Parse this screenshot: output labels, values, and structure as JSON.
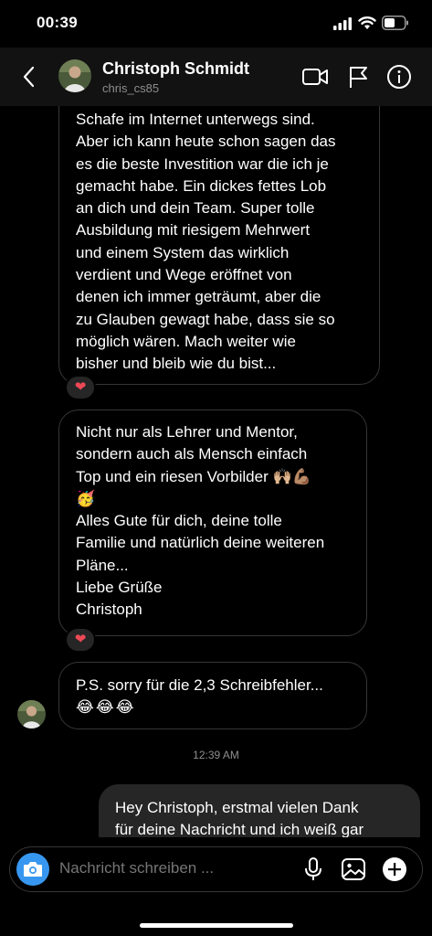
{
  "status_bar": {
    "time": "00:39"
  },
  "header": {
    "name": "Christoph Schmidt",
    "handle": "chris_cs85",
    "icons": [
      "back-arrow-icon",
      "video-call-icon",
      "flag-icon",
      "info-icon"
    ]
  },
  "messages": [
    {
      "lines": [
        "Schafe im Internet unterwegs sind.",
        "Aber ich kann heute schon sagen das",
        "es die beste Investition war die ich je",
        "gemacht habe. Ein dickes fettes Lob",
        "an dich und dein Team. Super tolle",
        "Ausbildung mit riesigem Mehrwert",
        "und einem System das wirklich",
        "verdient und Wege eröffnet von",
        "denen ich immer geträumt, aber die",
        "zu Glauben gewagt habe, dass sie so",
        "möglich wären. Mach weiter wie",
        "bisher und bleib wie du bist..."
      ],
      "reaction": "❤"
    },
    {
      "lines": [
        "Nicht nur als Lehrer und Mentor,",
        "sondern auch als Mensch einfach",
        "Top und ein riesen Vorbilder 🙌🏼💪🏽",
        "🥳",
        "Alles Gute für dich, deine tolle",
        "Familie und natürlich deine weiteren",
        "Pläne...",
        "Liebe Grüße",
        "Christoph"
      ],
      "reaction": "❤"
    },
    {
      "lines": [
        "P.S. sorry für die 2,3 Schreibfehler...",
        "😂😂😂"
      ]
    }
  ],
  "timestamp": "12:39 AM",
  "outgoing_message": {
    "lines": [
      "Hey Christoph, erstmal vielen Dank",
      "für deine Nachricht und ich weiß gar"
    ]
  },
  "composer": {
    "placeholder": "Nachricht schreiben ...",
    "icons": [
      "camera-icon",
      "microphone-icon",
      "gallery-icon",
      "plus-icon"
    ]
  },
  "colors": {
    "accent": "#3797f0",
    "bubble_out": "#262626",
    "border": "#363636",
    "heart": "#ed4956"
  }
}
